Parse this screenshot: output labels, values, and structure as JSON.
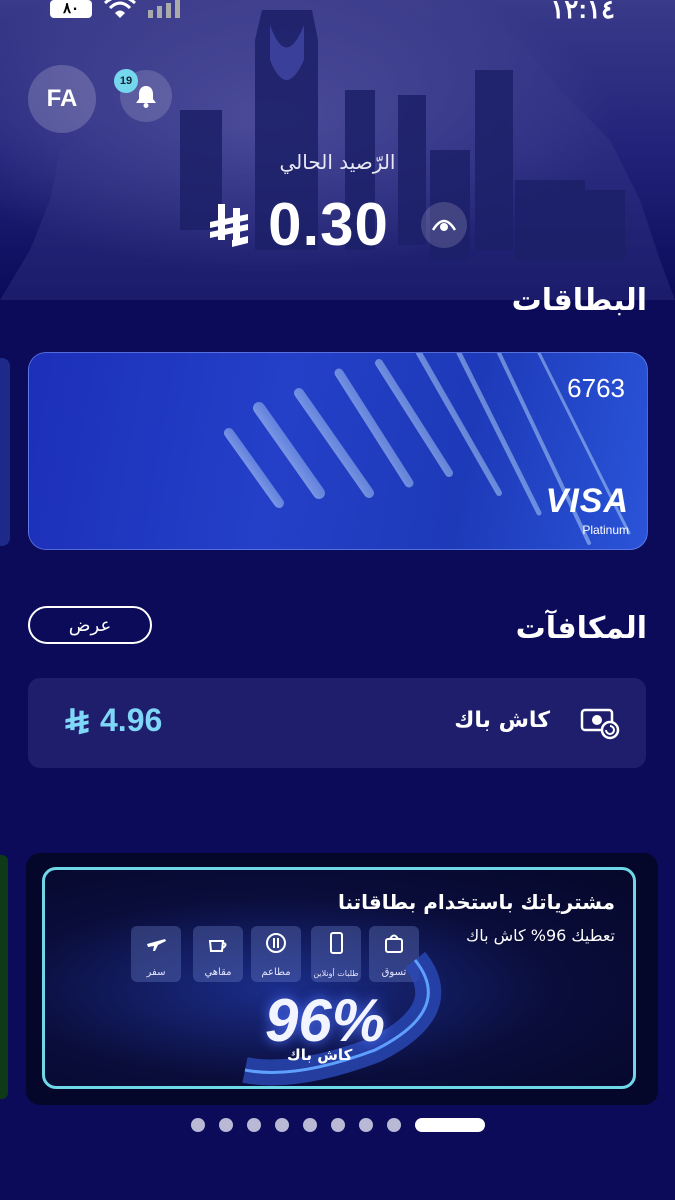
{
  "status_bar": {
    "time": "١٢:١٤",
    "battery": "٨٠"
  },
  "header": {
    "avatar_initials": "FA",
    "notifications_count": "19"
  },
  "balance": {
    "label": "الرّصيد الحالي",
    "amount": "0.30"
  },
  "cards_section": {
    "title": "البطاقات",
    "card": {
      "last_digits": "6763",
      "brand": "VISA",
      "tier": "Platinum"
    }
  },
  "rewards_section": {
    "title": "المكافآت",
    "view_button": "عرض",
    "cashback_label": "كاش باك",
    "cashback_amount": "4.96"
  },
  "promo_banner": {
    "title": "مشترياتك باستخدام بطاقاتنا",
    "subtitle": "تعطيك 96% كاش باك",
    "big_text": "96%",
    "big_sub": "كاش باك",
    "categories": [
      "تسوق",
      "طلبات أونلاين",
      "مطاعم",
      "مقاهي",
      "سفر"
    ]
  },
  "pager": {
    "total": 9,
    "active": 9
  },
  "colors": {
    "background": "#0b0b5a",
    "accent": "#7fd6f6",
    "banner_border": "#6fd8e8"
  }
}
